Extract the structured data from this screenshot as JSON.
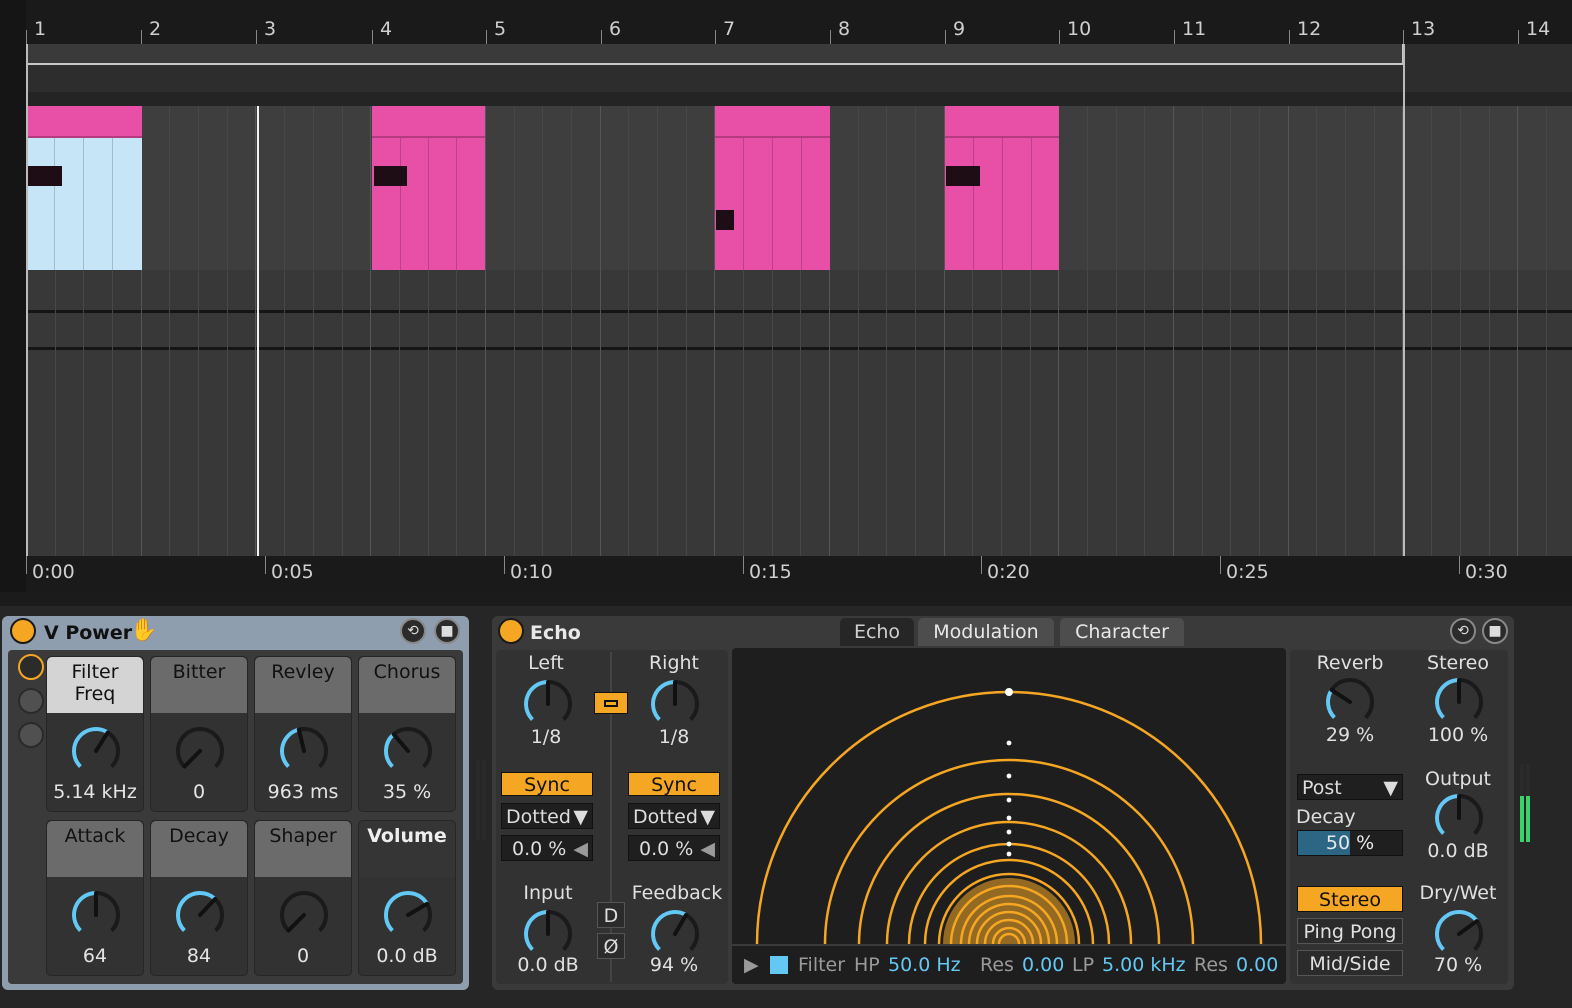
{
  "arrangement": {
    "bar_numbers": [
      "1",
      "2",
      "3",
      "4",
      "5",
      "6",
      "7",
      "8",
      "9",
      "10",
      "11",
      "12",
      "13",
      "14"
    ],
    "time_labels": [
      "0:00",
      "0:05",
      "0:10",
      "0:15",
      "0:20",
      "0:25",
      "0:30"
    ]
  },
  "vpower": {
    "title": "V Power",
    "macros": [
      {
        "label": "Filter\nFreq",
        "value": "5.14 kHz",
        "style": "light"
      },
      {
        "label": "Bitter",
        "value": "0",
        "style": "mid"
      },
      {
        "label": "Revley",
        "value": "963 ms",
        "style": "mid"
      },
      {
        "label": "Chorus",
        "value": "35 %",
        "style": "mid"
      },
      {
        "label": "Attack",
        "value": "64",
        "style": "mid"
      },
      {
        "label": "Decay",
        "value": "84",
        "style": "mid"
      },
      {
        "label": "Shaper",
        "value": "0",
        "style": "mid"
      },
      {
        "label": "Volume",
        "value": "0.0 dB",
        "style": "dark"
      }
    ]
  },
  "echo": {
    "title": "Echo",
    "tabs": [
      "Echo",
      "Modulation",
      "Character"
    ],
    "left": {
      "label": "Left",
      "value": "1/8",
      "sync": "Sync",
      "mode": "Dotted",
      "offset": "0.0 %"
    },
    "right": {
      "label": "Right",
      "value": "1/8",
      "sync": "Sync",
      "mode": "Dotted",
      "offset": "0.0 %"
    },
    "input": {
      "label": "Input",
      "value": "0.0 dB"
    },
    "feedback": {
      "label": "Feedback",
      "value": "94 %"
    },
    "d_button": "D",
    "phase_button": "Ø",
    "filter": {
      "label": "Filter",
      "hp_label": "HP",
      "hp_value": "50.0 Hz",
      "res1_label": "Res",
      "res1_value": "0.00",
      "lp_label": "LP",
      "lp_value": "5.00 kHz",
      "res2_label": "Res",
      "res2_value": "0.00"
    },
    "reverb": {
      "label": "Reverb",
      "value": "29 %"
    },
    "stereo": {
      "label": "Stereo",
      "value": "100 %"
    },
    "reverb_position": "Post",
    "decay": {
      "label": "Decay",
      "value": "50 %"
    },
    "output": {
      "label": "Output",
      "value": "0.0 dB"
    },
    "drywet": {
      "label": "Dry/Wet",
      "value": "70 %"
    },
    "modes": [
      "Stereo",
      "Ping Pong",
      "Mid/Side"
    ],
    "active_mode": "Stereo"
  },
  "colors": {
    "accent": "#f5a623",
    "clip": "#e84fa6",
    "selected_clip": "#c6e6f8",
    "knob_arc": "#64c8f5"
  }
}
